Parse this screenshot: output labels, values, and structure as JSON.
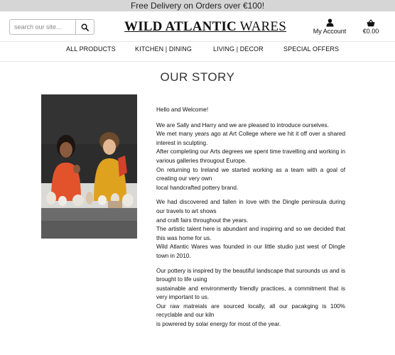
{
  "banner": {
    "text": "Free Delivery on Orders over €100!"
  },
  "header": {
    "search_placeholder": "search our site...",
    "logo_part1": "WILD ATLANTIC",
    "logo_part2": " WARES",
    "account_label": "My Account",
    "cart_total": "€0.00"
  },
  "nav": {
    "items": [
      "ALL PRODUCTS",
      "KITCHEN | DINING",
      "LIVING | DECOR",
      "SPECIAL OFFERS"
    ]
  },
  "page": {
    "title": "OUR STORY",
    "greeting": "Hello and Welcome!",
    "para1": [
      "We are Sally and Harry and we are pleased to introduce ourselves.",
      "We met many years ago at Art College where we hit it off over a shared interest in sculpting.",
      "After completing our Arts degrees we spent time travelling and working in various galleries througout Europe.",
      "On returning to Ireland we started working as a team with a goal of creating our very own",
      "local handcrafted pottery brand."
    ],
    "para2": [
      "We had discovered and fallen in love with the Dingle peninsula during our travels to art shows",
      "and craft fairs throughout the years.",
      "The artistic talent here is abundant and inspiring and so we decided that this was home for us.",
      "Wild Atlantic Wares was founded in our little studio just west of Dingle town in 2010."
    ],
    "para3": [
      "Our pottery is inspired by the beautiful landscape that surounds us and is brought to life using",
      "sustainable and environmently friendly practices, a commitment that is very important to us.",
      "Our raw matreials are sourced locally, all our pacakging is 100% recyclable and our kiln",
      "is powrered by solar energy for most of the year."
    ]
  },
  "icons": {
    "search": "search-icon",
    "account": "user-icon",
    "cart": "shopping-basket-icon"
  },
  "colors": {
    "banner_bg": "#d6d6d6",
    "title": "#333333"
  }
}
